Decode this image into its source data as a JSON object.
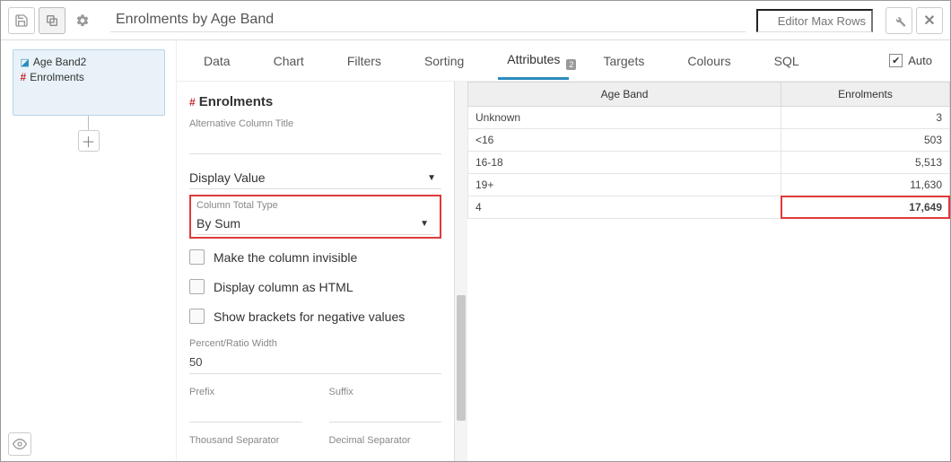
{
  "toolbar": {
    "title_value": "Enrolments by Age Band",
    "editor_rows_placeholder": "Editor Max Rows"
  },
  "data_card": {
    "dim_label": "Age Band2",
    "measure_label": "Enrolments"
  },
  "tabs": {
    "items": [
      "Data",
      "Chart",
      "Filters",
      "Sorting",
      "Attributes",
      "Targets",
      "Colours",
      "SQL"
    ],
    "active_index": 4,
    "attributes_badge": "2",
    "auto_label": "Auto"
  },
  "attr": {
    "section_title": "Enrolments",
    "alt_title_label": "Alternative Column Title",
    "alt_title_value": "",
    "display_value_label": "Display Value",
    "column_total_type_label": "Column Total Type",
    "column_total_type_value": "By Sum",
    "chk_invisible": "Make the column invisible",
    "chk_html": "Display column as HTML",
    "chk_brackets": "Show brackets for negative values",
    "percent_width_label": "Percent/Ratio Width",
    "percent_width_value": "50",
    "prefix_label": "Prefix",
    "suffix_label": "Suffix",
    "thousand_sep_label": "Thousand Separator",
    "decimal_sep_label": "Decimal Separator"
  },
  "table": {
    "headers": [
      "Age Band",
      "Enrolments"
    ],
    "rows": [
      {
        "label": "Unknown",
        "value": "3"
      },
      {
        "label": "<16",
        "value": "503"
      },
      {
        "label": "16-18",
        "value": "5,513"
      },
      {
        "label": "19+",
        "value": "11,630"
      }
    ],
    "total_label": "4",
    "total_value": "17,649"
  }
}
